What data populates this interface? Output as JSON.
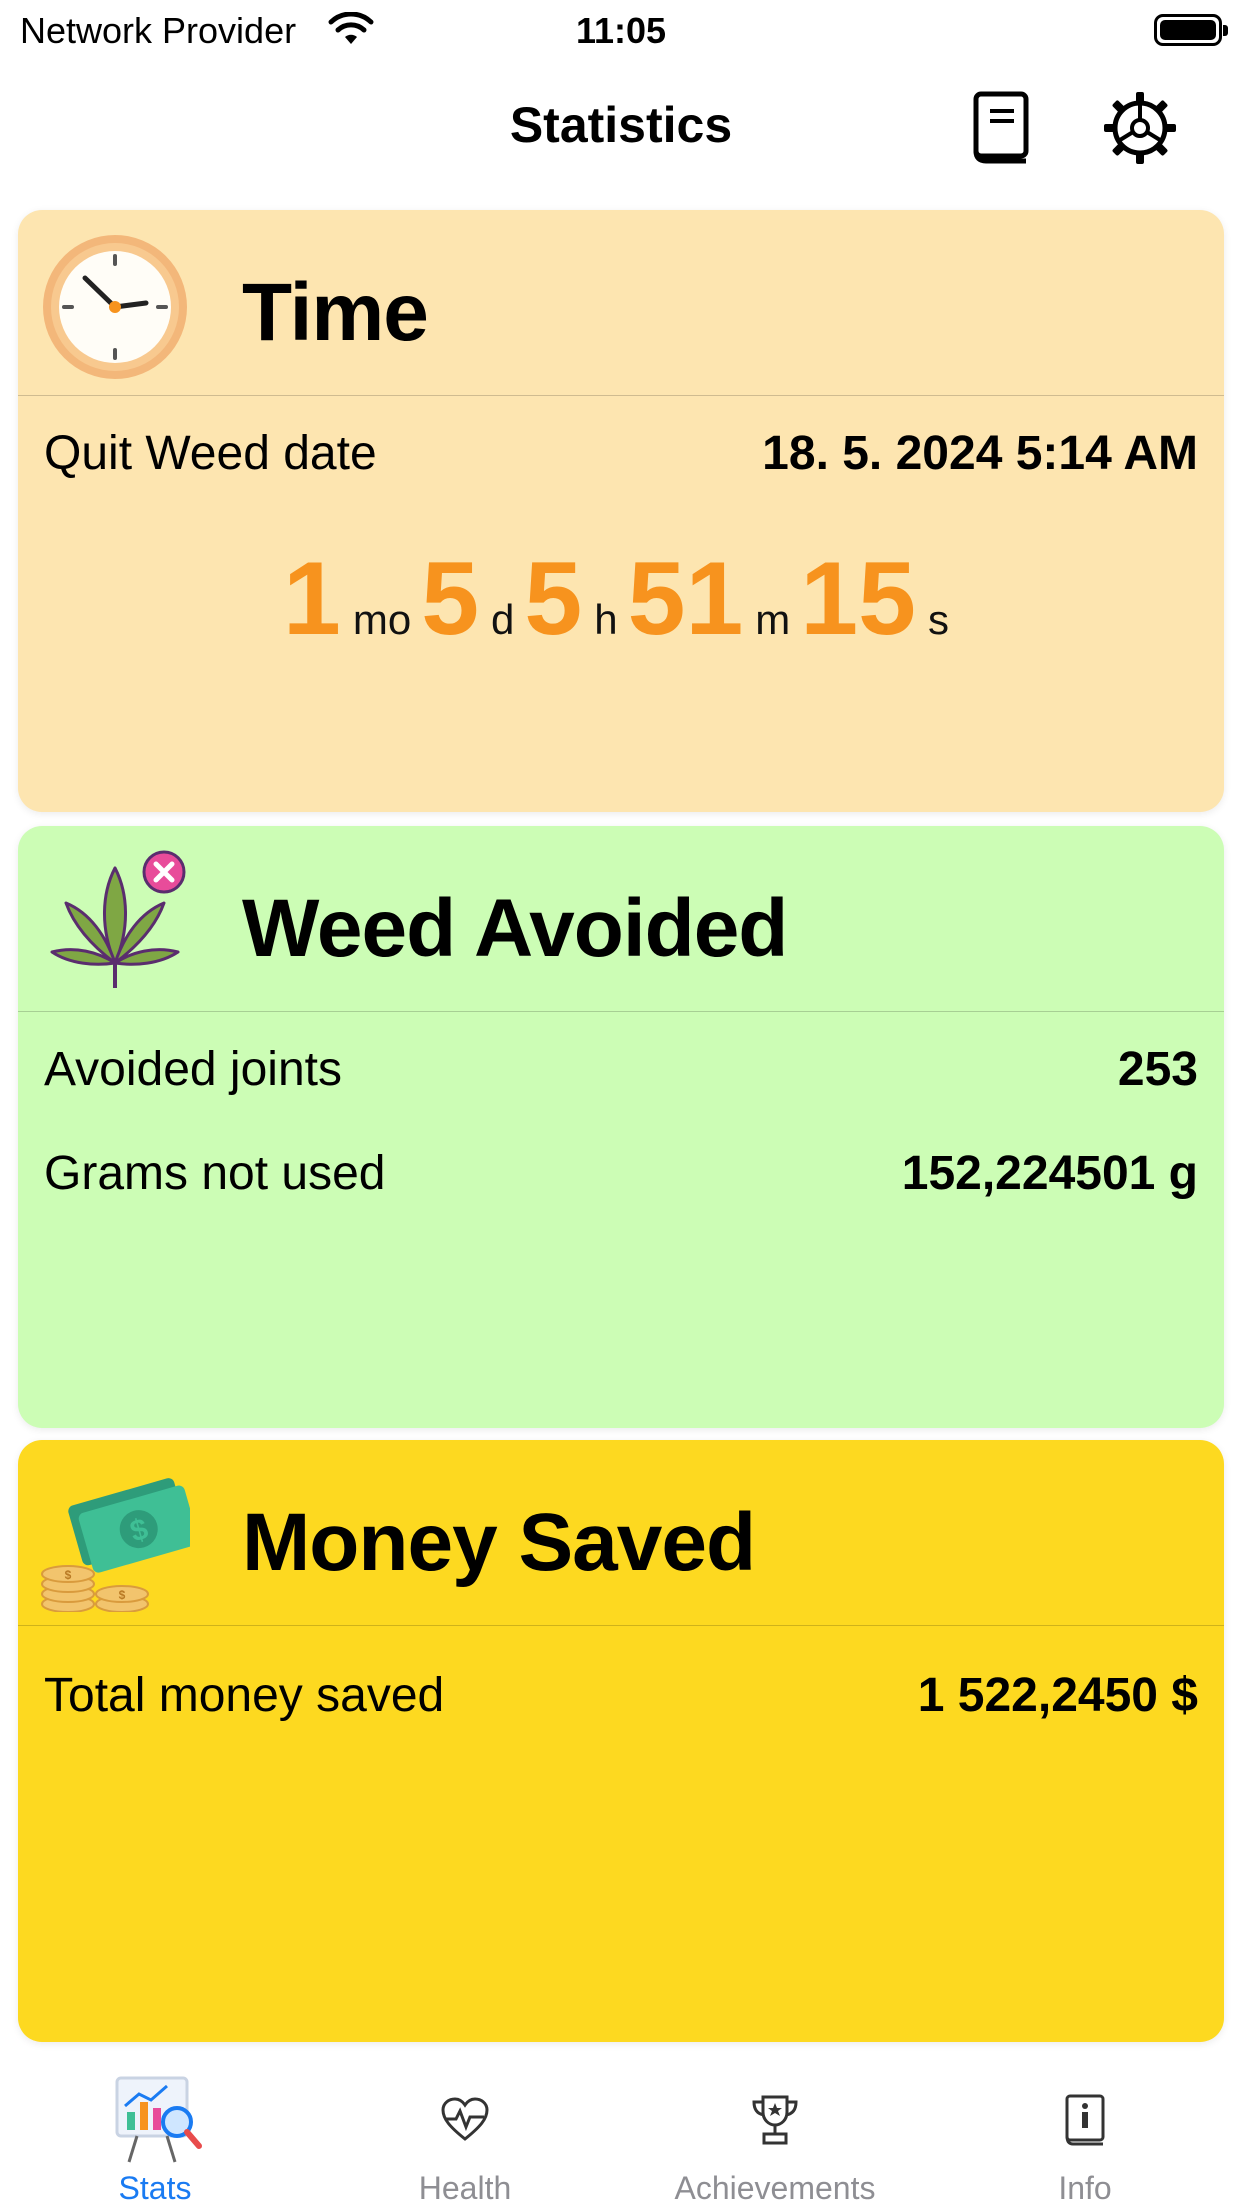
{
  "status_bar": {
    "carrier": "Network Provider",
    "time": "11:05"
  },
  "nav": {
    "title": "Statistics",
    "left_button_icon": "book-icon",
    "right_button_icon": "settings-gear-icon"
  },
  "time_card": {
    "title": "Time",
    "icon": "clock-icon",
    "color": "#fde5b0",
    "quit_label": "Quit Weed date",
    "quit_value": "18. 5. 2024 5:14 AM",
    "counter": {
      "months": "1",
      "months_unit": "mo",
      "days": "5",
      "days_unit": "d",
      "hours": "5",
      "hours_unit": "h",
      "minutes": "51",
      "minutes_unit": "m",
      "seconds": "15",
      "seconds_unit": "s",
      "accent": "#f7931e"
    }
  },
  "weed_card": {
    "title": "Weed Avoided",
    "icon": "cannabis-leaf-icon",
    "color": "#ccfdb5",
    "rows": [
      {
        "label": "Avoided joints",
        "value": "253"
      },
      {
        "label": "Grams not used",
        "value": "152,224501 g"
      }
    ]
  },
  "money_card": {
    "title": "Money Saved",
    "icon": "money-cash-icon",
    "color": "#fdd920",
    "rows": [
      {
        "label": "Total money saved",
        "value": "1 522,2450 $"
      }
    ]
  },
  "tabs": [
    {
      "label": "Stats",
      "icon": "stats-chart-icon",
      "active": true
    },
    {
      "label": "Health",
      "icon": "heartbeat-icon",
      "active": false
    },
    {
      "label": "Achievements",
      "icon": "trophy-icon",
      "active": false
    },
    {
      "label": "Info",
      "icon": "info-book-icon",
      "active": false
    }
  ],
  "accent_color": "#1a7bf2"
}
